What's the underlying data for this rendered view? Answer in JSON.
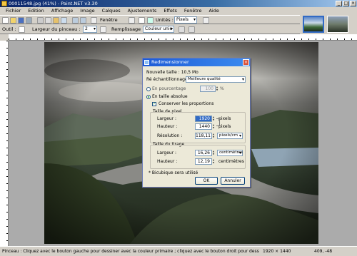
{
  "window": {
    "title": "00011548.jpg (41%) - Paint.NET v3.30"
  },
  "menu": [
    "Fichier",
    "Edition",
    "Affichage",
    "Image",
    "Calques",
    "Ajustements",
    "Effets",
    "Fenêtre",
    "Aide"
  ],
  "toolbar": {
    "window_label": "Fenêtre",
    "units_label": "Unités :",
    "units_value": "Pixels"
  },
  "tool_options": {
    "tool_label": "Outil :",
    "brush_label": "Largeur du pinceau :",
    "brush_value": "2",
    "fill_label": "Remplissage :",
    "fill_value": "Couleur unie"
  },
  "dialog": {
    "title": "Redimensionner",
    "new_size": "Nouvelle taille : 10,5 Mo",
    "resampling_label": "Ré échantillonnage :",
    "resampling_value": "Meilleure qualité",
    "percent_label": "En pourcentage",
    "percent_value": "100",
    "percent_unit": "%",
    "absolute_label": "En taille absolue",
    "keep_ratio_label": "Conserver les proportions",
    "pixel_size_label": "Taille de pixel",
    "width_label": "Largeur :",
    "width_value": "1920",
    "width_unit": "pixels",
    "height_label": "Hauteur :",
    "height_value": "1440",
    "height_unit": "pixels",
    "resolution_label": "Résolution :",
    "resolution_value": "118,11",
    "resolution_unit": "pixels/cm",
    "print_size_label": "Taille du tirage",
    "print_width_label": "Largeur :",
    "print_width_value": "16,26",
    "print_width_unit": "centimètres",
    "print_height_label": "Hauteur :",
    "print_height_value": "12,19",
    "print_height_unit": "centimètres",
    "note": "* Bicubique sera utilisé",
    "ok_label": "OK",
    "cancel_label": "Annuler"
  },
  "status": {
    "hint": "Pinceau : Cliquez avec le bouton gauche pour dessiner avec la couleur primaire ; cliquez avec le bouton droit pour dessiner avec la couleur s",
    "image_size": "1920 × 1440",
    "cursor": "409, -48"
  },
  "colors": {
    "title_bar": "#0a246a",
    "dialog_title": "#1d5ad6",
    "workspace": "#ababab"
  }
}
